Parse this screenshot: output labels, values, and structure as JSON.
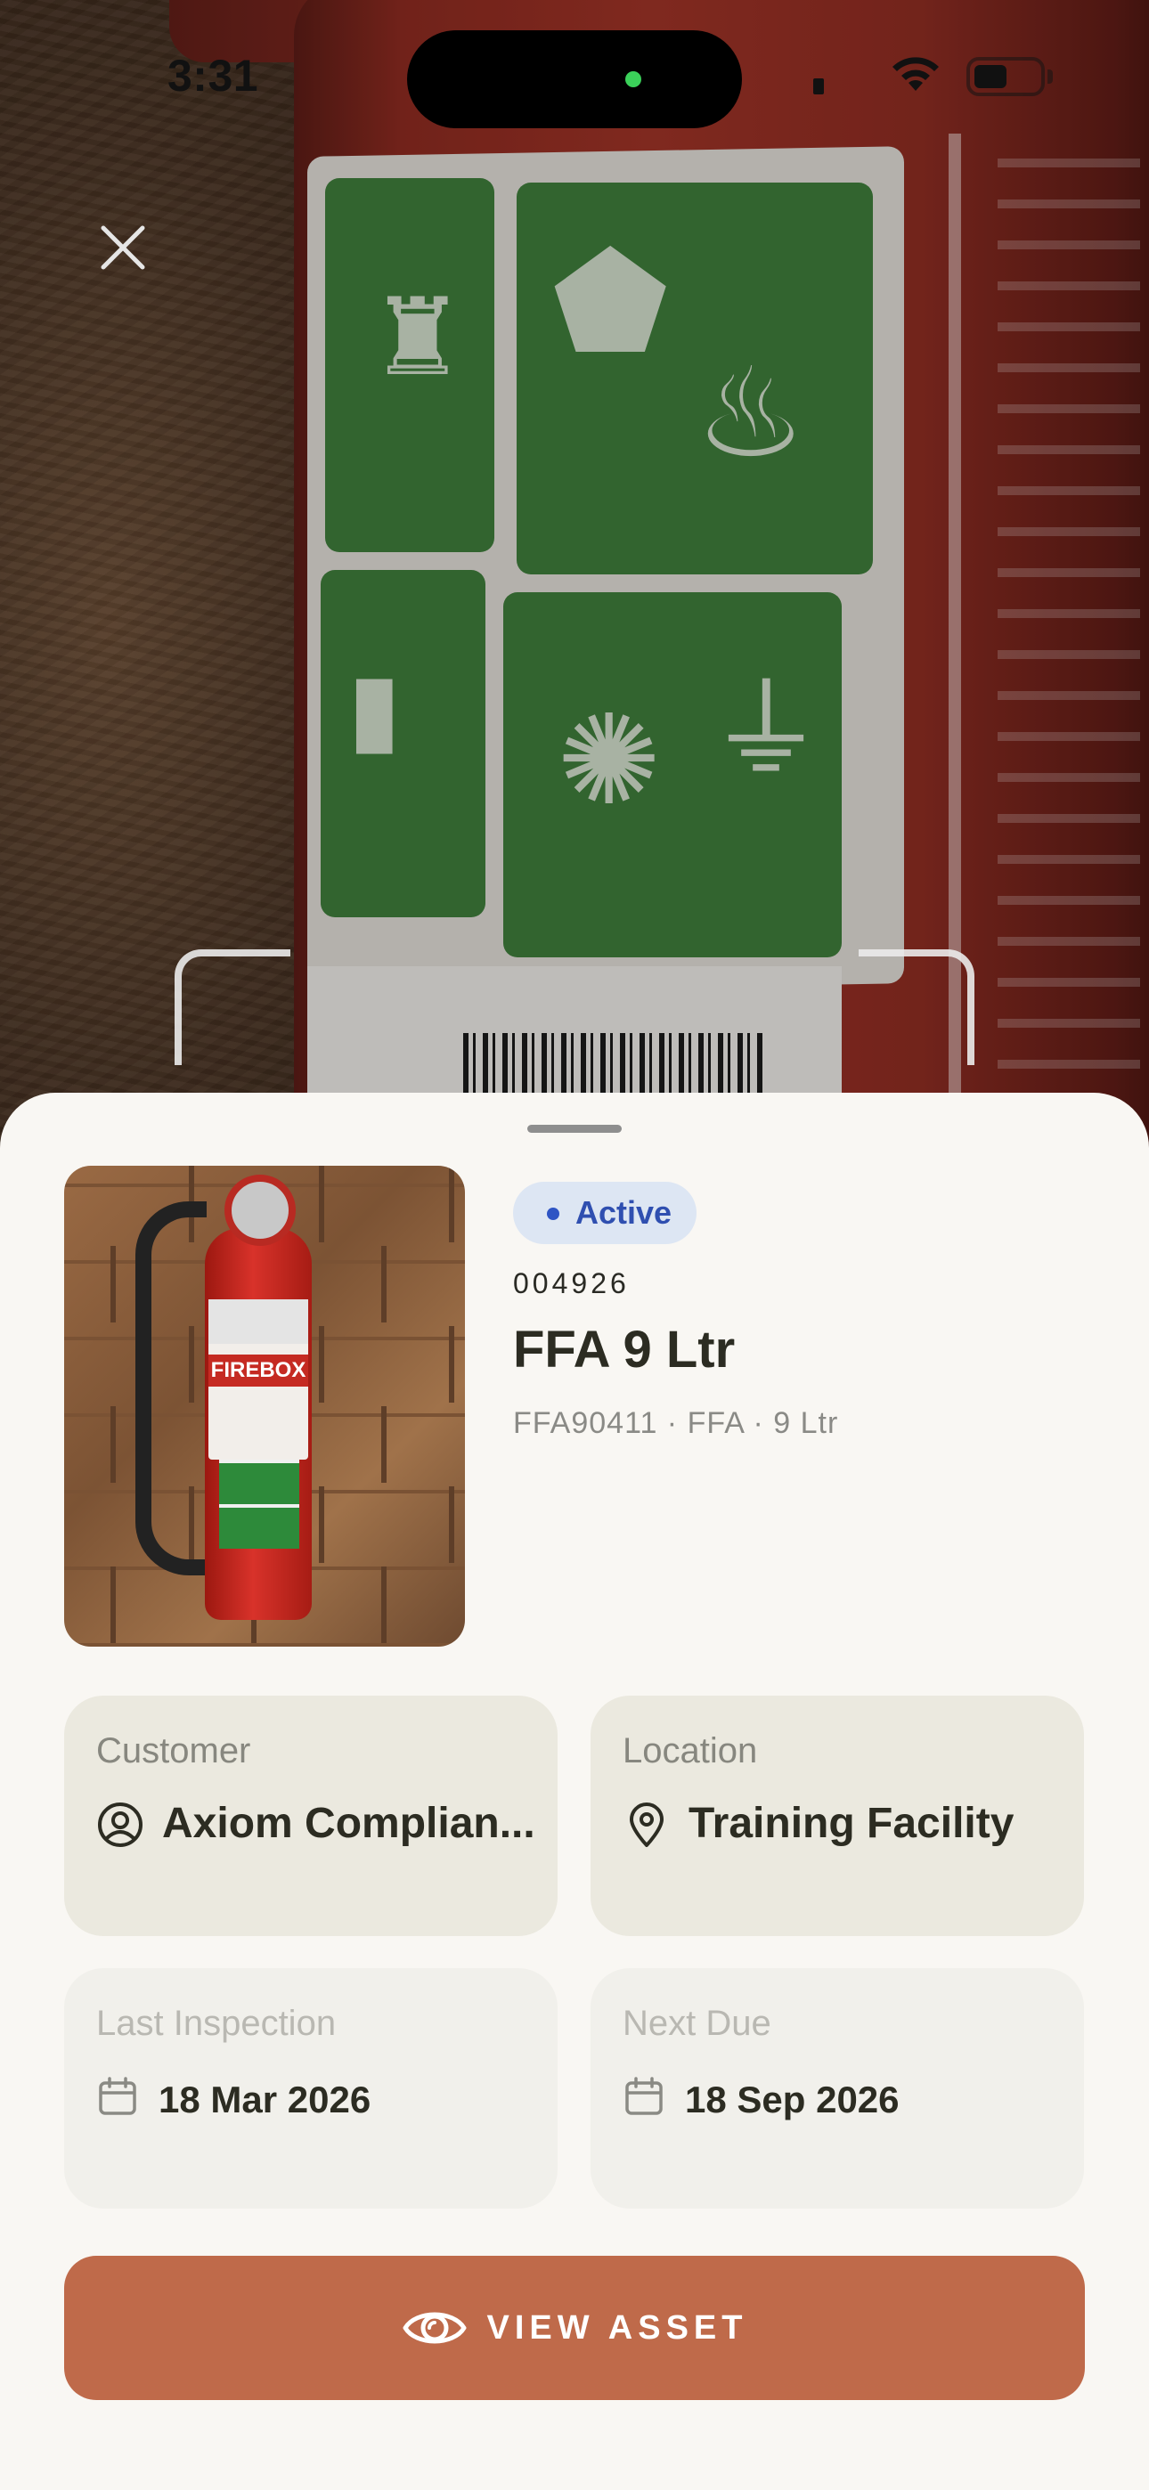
{
  "status_bar": {
    "time": "3:31"
  },
  "camera": {
    "close_icon": "close-icon"
  },
  "asset": {
    "status": "Active",
    "id": "004926",
    "name": "FFA 9 Ltr",
    "meta": "FFA90411 · FFA · 9 Ltr",
    "photo_brand": "FIREBOX"
  },
  "details": {
    "customer": {
      "label": "Customer",
      "value": "Axiom Complian...",
      "icon": "user-circle-icon"
    },
    "location": {
      "label": "Location",
      "value": "Training Facility",
      "icon": "map-pin-icon"
    },
    "last_inspection": {
      "label": "Last Inspection",
      "value": "18 Mar 2026",
      "icon": "calendar-icon"
    },
    "next_due": {
      "label": "Next Due",
      "value": "18 Sep 2026",
      "icon": "calendar-icon"
    }
  },
  "actions": {
    "view_asset": "VIEW ASSET"
  },
  "colors": {
    "accent": "#bf6a4a",
    "status_pill_bg": "#dde6f3",
    "status_pill_text": "#2f4fb0",
    "sheet_bg": "#f9f7f3",
    "card_bg": "#ebe9df"
  }
}
